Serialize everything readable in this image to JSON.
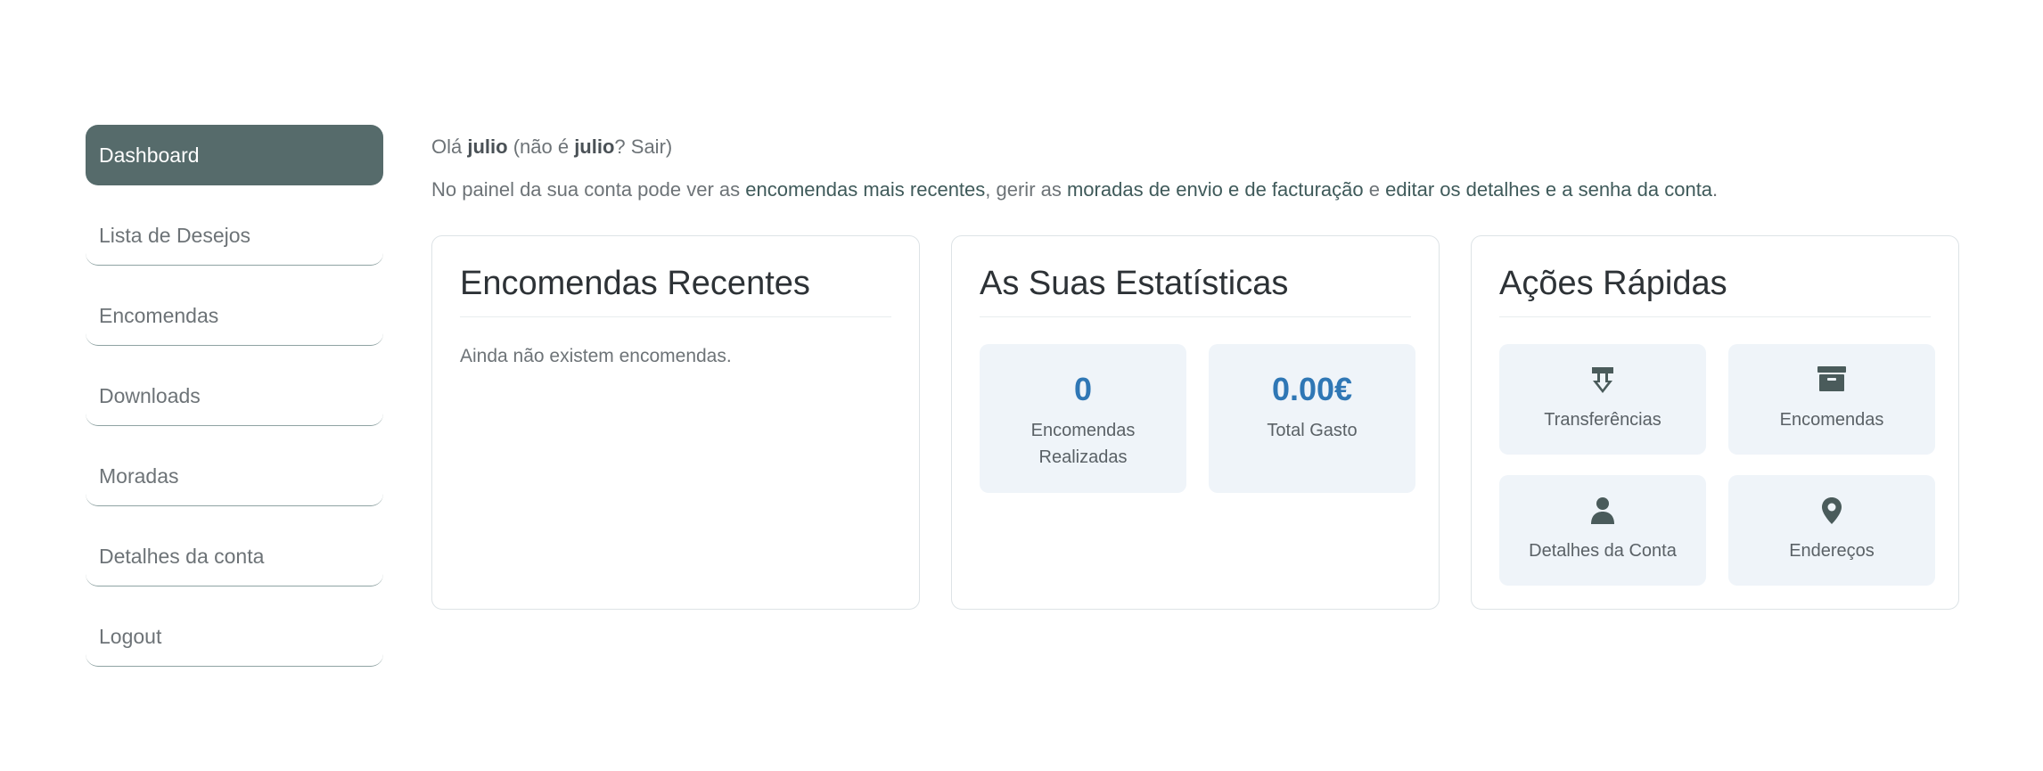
{
  "sidebar": {
    "items": [
      {
        "label": "Dashboard"
      },
      {
        "label": "Lista de Desejos"
      },
      {
        "label": "Encomendas"
      },
      {
        "label": "Downloads"
      },
      {
        "label": "Moradas"
      },
      {
        "label": "Detalhes da conta"
      },
      {
        "label": "Logout"
      }
    ]
  },
  "greeting": {
    "prefix": "Olá ",
    "user": "julio",
    "middle": " (não é ",
    "user2": "julio",
    "q": "? ",
    "logout": "Sair",
    "suffix": ")"
  },
  "intro": {
    "t1": "No painel da sua conta pode ver as ",
    "link1": "encomendas mais recentes",
    "t2": ", gerir as ",
    "link2": "moradas de envio e de facturação",
    "t3": " e ",
    "link3": "editar os detalhes e a senha da conta",
    "t4": "."
  },
  "recent": {
    "title": "Encomendas Recentes",
    "empty": "Ainda não existem encomendas."
  },
  "stats": {
    "title": "As Suas Estatísticas",
    "items": [
      {
        "value": "0",
        "label": "Encomendas Realizadas"
      },
      {
        "value": "0.00€",
        "label": "Total Gasto"
      }
    ]
  },
  "quick": {
    "title": "Ações Rápidas",
    "items": [
      {
        "label": "Transferências",
        "icon": "download-icon"
      },
      {
        "label": "Encomendas",
        "icon": "archive-box-icon"
      },
      {
        "label": "Detalhes da Conta",
        "icon": "user-icon"
      },
      {
        "label": "Endereços",
        "icon": "map-pin-icon"
      }
    ]
  },
  "colors": {
    "accent": "#566b6b",
    "stat_value": "#2f77b5",
    "tile_bg": "#eff4f9"
  }
}
